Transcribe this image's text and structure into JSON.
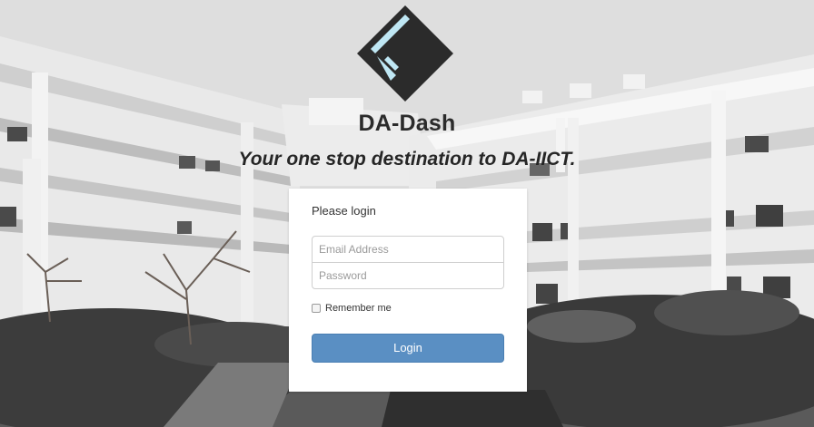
{
  "brand": {
    "title": "DA-Dash",
    "tagline": "Your one stop destination to DA-IICT.",
    "logo_icon": "da-dash-logo-icon",
    "logo_color": "#2b2b2b",
    "logo_accent": "#bfe7f4"
  },
  "login": {
    "heading": "Please login",
    "email_placeholder": "Email Address",
    "password_placeholder": "Password",
    "remember_label": "Remember me",
    "submit_label": "Login",
    "button_color": "#5a8fc3"
  }
}
